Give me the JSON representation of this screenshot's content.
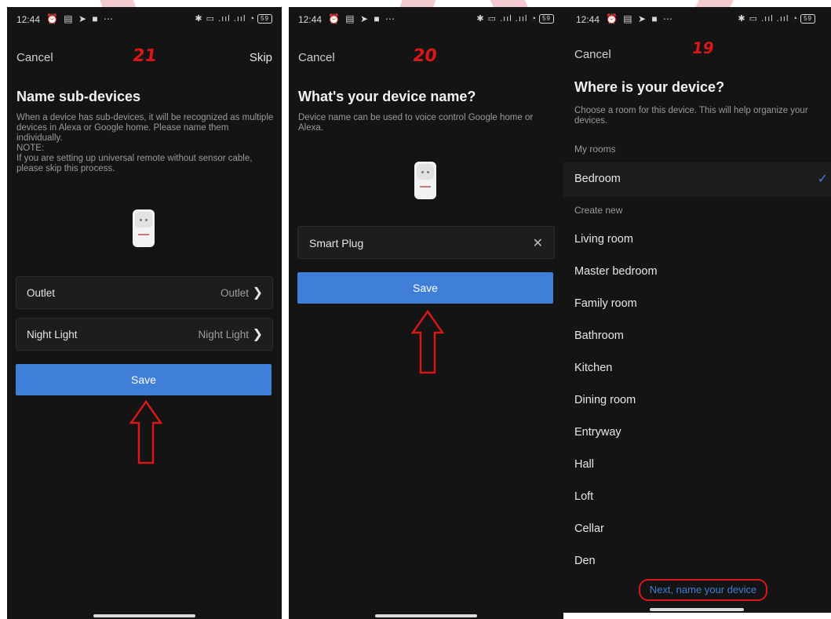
{
  "status": {
    "time": "12:44",
    "battery": "59"
  },
  "screens": [
    {
      "step": "21",
      "cancel": "Cancel",
      "skip": "Skip",
      "title": "Name sub-devices",
      "description": "When a device has sub-devices, it will be recognized as multiple devices in Alexa or Google home. Please name them individually.",
      "note_label": "NOTE:",
      "note": "If you are setting up universal remote without sensor cable, please skip this process.",
      "rows": [
        {
          "label": "Outlet",
          "value": "Outlet"
        },
        {
          "label": "Night Light",
          "value": "Night Light"
        }
      ],
      "save": "Save"
    },
    {
      "step": "20",
      "cancel": "Cancel",
      "title": "What's your device name?",
      "description": "Device name can be used to voice control Google home or Alexa.",
      "input_value": "Smart Plug",
      "save": "Save"
    },
    {
      "step": "19",
      "cancel": "Cancel",
      "title": "Where is your device?",
      "description": "Choose a room for this device. This will help organize your devices.",
      "my_rooms_label": "My rooms",
      "my_rooms": [
        "Bedroom"
      ],
      "selected_room": "Bedroom",
      "create_new_label": "Create new",
      "new_rooms": [
        "Living room",
        "Master bedroom",
        "Family room",
        "Bathroom",
        "Kitchen",
        "Dining room",
        "Entryway",
        "Hall",
        "Loft",
        "Cellar",
        "Den"
      ],
      "next": "Next, name your device"
    }
  ],
  "colors": {
    "accent": "#3f7fd8",
    "annotation": "#d81818",
    "background": "#141414"
  }
}
